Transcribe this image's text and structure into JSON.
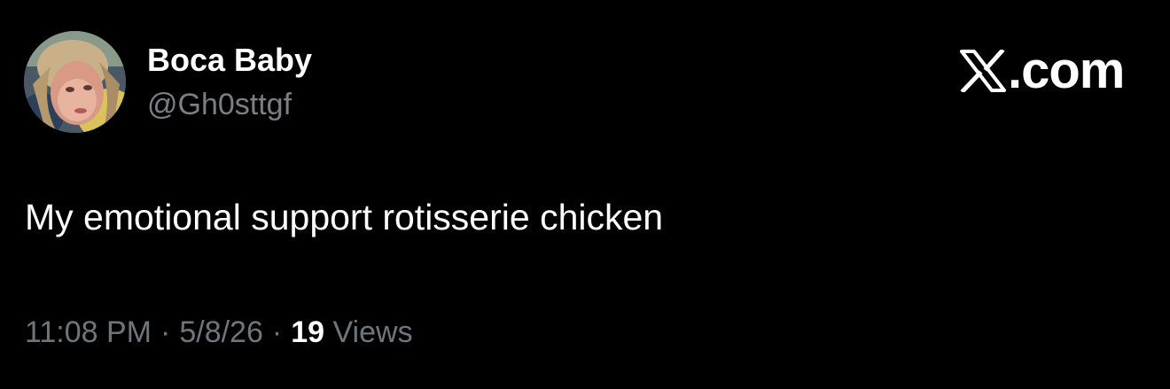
{
  "author": {
    "display_name": "Boca Baby",
    "handle": "@Gh0sttgf"
  },
  "brand": {
    "icon": "x-logo-icon",
    "domain": ".com"
  },
  "tweet": {
    "text": "My emotional support rotisserie chicken"
  },
  "meta": {
    "time": "11:08 PM",
    "separator": "·",
    "date": "5/8/26",
    "views_count": "19",
    "views_label": "Views"
  }
}
